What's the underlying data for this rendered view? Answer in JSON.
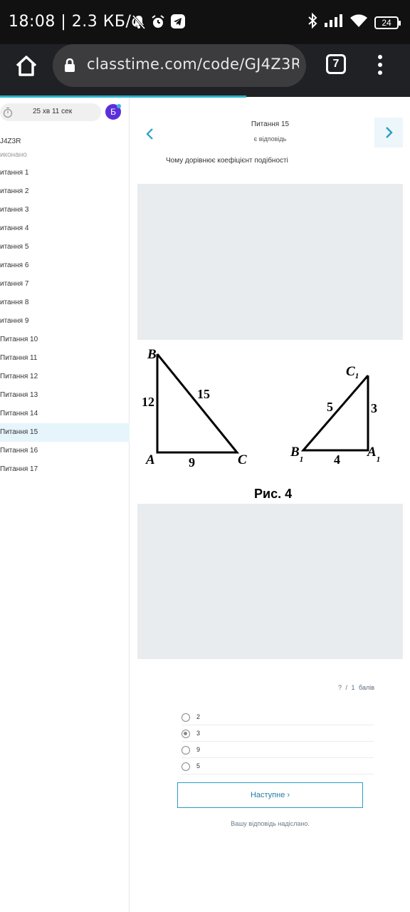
{
  "status_bar": {
    "time_speed": "18:08  |  2.3  КБ/с",
    "battery": "24"
  },
  "browser": {
    "url": "classtime.com/code/GJ4Z3R/",
    "tab_count": "7"
  },
  "sidebar": {
    "timer": "25 хв 11 сек",
    "avatar_letter": "Б",
    "code": "J4Z3R",
    "status": "иконано",
    "questions": [
      {
        "label": "итання 1"
      },
      {
        "label": "итання 2"
      },
      {
        "label": "итання 3"
      },
      {
        "label": "итання 4"
      },
      {
        "label": "итання 5"
      },
      {
        "label": "итання 6"
      },
      {
        "label": "итання 7"
      },
      {
        "label": "итання 8"
      },
      {
        "label": "итання 9"
      },
      {
        "label": "Питання 10"
      },
      {
        "label": "Питання 11"
      },
      {
        "label": "Питання 12"
      },
      {
        "label": "Питання 13"
      },
      {
        "label": "Питання 14"
      },
      {
        "label": "Питання 15"
      },
      {
        "label": "Питання 16"
      },
      {
        "label": "Питання 17"
      }
    ],
    "active_index": 14
  },
  "question": {
    "title": "Питання 15",
    "subtitle": "є відповідь",
    "text": "Чому дорівнює коефіцієнт подібності",
    "figure": {
      "caption": "Рис. 4",
      "t1": {
        "A": "A",
        "B": "B",
        "C": "C",
        "AB": "12",
        "BC": "15",
        "AC": "9"
      },
      "t2": {
        "A": "A",
        "B": "B",
        "C": "C",
        "sub": "1",
        "B1C1": "5",
        "C1A1": "3",
        "B1A1": "4"
      }
    },
    "score": "? / 1 балів",
    "options": [
      {
        "label": "2",
        "checked": false
      },
      {
        "label": "3",
        "checked": true
      },
      {
        "label": "9",
        "checked": false
      },
      {
        "label": "5",
        "checked": false
      }
    ],
    "next_button": "Наступне",
    "sent_message": "Вашу відповідь надіслано."
  },
  "colors": {
    "accent": "#2a9cc4",
    "avatar": "#5b2fd9"
  }
}
